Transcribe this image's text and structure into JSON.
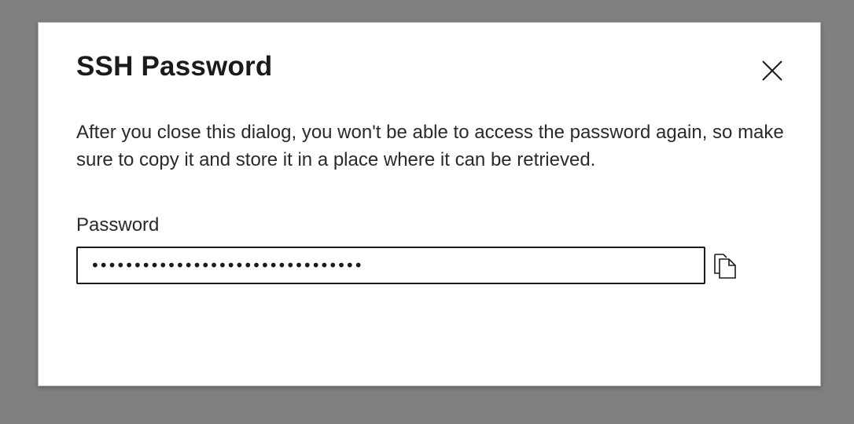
{
  "dialog": {
    "title": "SSH Password",
    "description": "After you close this dialog, you won't be able to access the password again, so make sure to copy it and store it in a place where it can be retrieved.",
    "close_icon": "close-icon",
    "password_field": {
      "label": "Password",
      "value": "••••••••••••••••••••••••••••••••",
      "type": "password"
    },
    "copy_icon": "copy-icon"
  },
  "colors": {
    "overlay": "#808080",
    "dialog_bg": "#ffffff",
    "text": "#1b1b1b",
    "input_border": "#1b1b1b"
  }
}
